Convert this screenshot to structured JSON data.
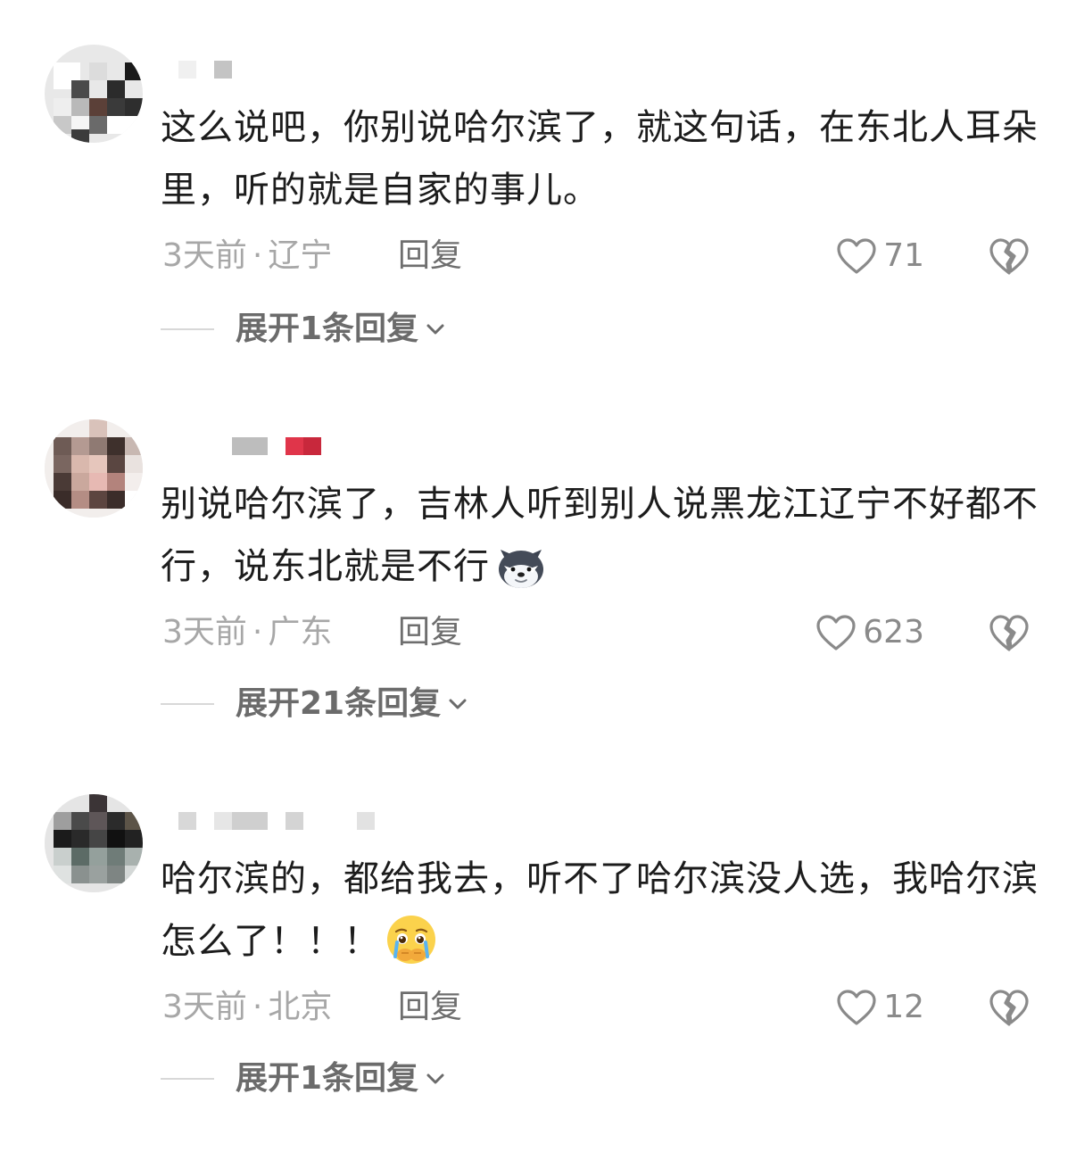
{
  "comments": [
    {
      "text": "这么说吧，你别说哈尔滨了，就这句话，在东北人耳朵里，听的就是自家的事儿。",
      "time": "3天前",
      "location": "辽宁",
      "reply_label": "回复",
      "likes": "71",
      "expand_label": "展开1条回复",
      "emoji": ""
    },
    {
      "text": "别说哈尔滨了，吉林人听到别人说黑龙江辽宁不好都不行，说东北就是不行",
      "time": "3天前",
      "location": "广东",
      "reply_label": "回复",
      "likes": "623",
      "expand_label": "展开21条回复",
      "emoji": "wolf-emoji"
    },
    {
      "text": "哈尔滨的，都给我去，听不了哈尔滨没人选，我哈尔滨怎么了！！！",
      "time": "3天前",
      "location": "北京",
      "reply_label": "回复",
      "likes": "12",
      "expand_label": "展开1条回复",
      "emoji": "crying-emoji"
    }
  ],
  "meta_separator": "·",
  "colors": {
    "text": "#1c1c1c",
    "meta": "#a7a7a7",
    "action": "#6e6e6e",
    "icon": "#8a8a8a"
  }
}
